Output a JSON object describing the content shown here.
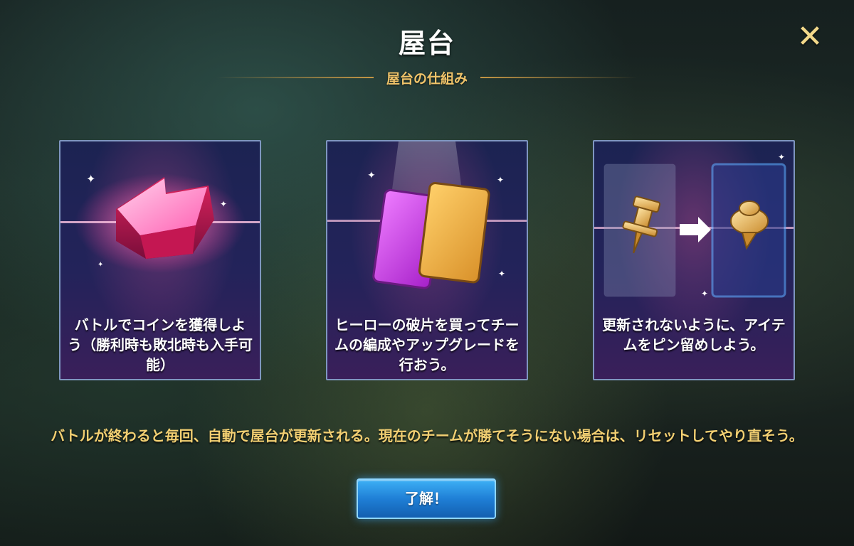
{
  "header": {
    "title": "屋台",
    "close_icon": "close-icon",
    "subtitle": "屋台の仕組み"
  },
  "cards": [
    {
      "icon": "pink-gem-icon",
      "text": "バトルでコインを獲得しよう（勝利時も敗北時も入手可能）"
    },
    {
      "icon": "hero-shard-cards-icon",
      "text": "ヒーローの破片を買ってチームの編成やアップグレードを行おう。"
    },
    {
      "icon": "pin-item-icon",
      "text": "更新されないように、アイテムをピン留めしよう。"
    }
  ],
  "body_text": "バトルが終わると毎回、自動で屋台が更新される。現在のチームが勝てそうにない場合は、リセットしてやり直そう。",
  "ok_button": {
    "label": "了解！"
  },
  "colors": {
    "title": "#ffffff",
    "subtitle": "#f0c46a",
    "body_text": "#f2cf72",
    "button": "#1f7fd6",
    "close_icon": "#f3d98a"
  }
}
